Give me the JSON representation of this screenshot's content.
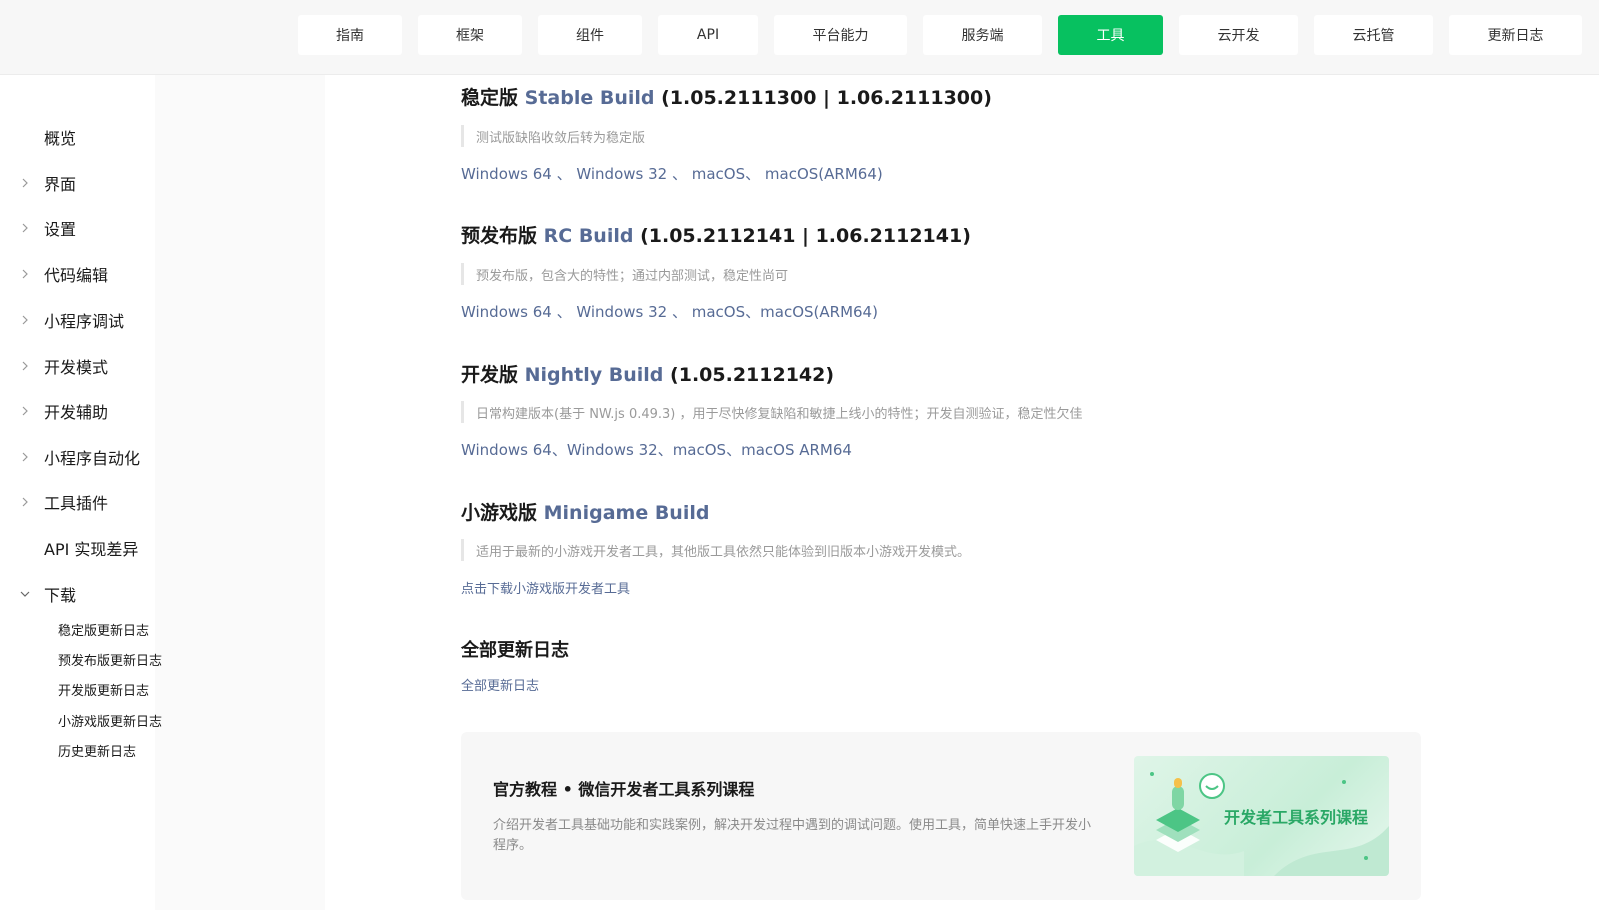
{
  "topnav": {
    "tabs": [
      {
        "label": "指南"
      },
      {
        "label": "框架"
      },
      {
        "label": "组件"
      },
      {
        "label": "API"
      },
      {
        "label": "平台能力"
      },
      {
        "label": "服务端"
      },
      {
        "label": "工具",
        "active": true
      },
      {
        "label": "云开发"
      },
      {
        "label": "云托管"
      },
      {
        "label": "更新日志"
      }
    ]
  },
  "sidebar": {
    "items": [
      {
        "label": "概览",
        "chevron": "none"
      },
      {
        "label": "界面",
        "chevron": "right"
      },
      {
        "label": "设置",
        "chevron": "right"
      },
      {
        "label": "代码编辑",
        "chevron": "right"
      },
      {
        "label": "小程序调试",
        "chevron": "right"
      },
      {
        "label": "开发模式",
        "chevron": "right"
      },
      {
        "label": "开发辅助",
        "chevron": "right"
      },
      {
        "label": "小程序自动化",
        "chevron": "right"
      },
      {
        "label": "工具插件",
        "chevron": "right"
      },
      {
        "label": "API 实现差异",
        "chevron": "none"
      },
      {
        "label": "下载",
        "chevron": "down"
      }
    ],
    "subitems": [
      {
        "label": "稳定版更新日志"
      },
      {
        "label": "预发布版更新日志"
      },
      {
        "label": "开发版更新日志"
      },
      {
        "label": "小游戏版更新日志"
      },
      {
        "label": "历史更新日志"
      }
    ]
  },
  "sections": {
    "stable": {
      "title_cn": "稳定版",
      "title_en": "Stable Build",
      "version": "(1.05.2111300 | 1.06.2111300)",
      "note": "测试版缺陷收敛后转为稳定版",
      "links": [
        "Windows 64",
        "Windows 32",
        "macOS",
        "macOS(ARM64)"
      ],
      "seps": [
        " 、 ",
        " 、 ",
        "、 "
      ]
    },
    "rc": {
      "title_cn": "预发布版",
      "title_en": "RC Build",
      "version": "(1.05.2112141 | 1.06.2112141)",
      "note": "预发布版，包含大的特性；通过内部测试，稳定性尚可",
      "links": [
        "Windows 64",
        "Windows 32",
        "macOS",
        "macOS(ARM64)"
      ],
      "seps": [
        " 、 ",
        " 、 ",
        "、"
      ]
    },
    "nightly": {
      "title_cn": "开发版",
      "title_en": "Nightly Build",
      "version": "(1.05.2112142)",
      "note": "日常构建版本(基于 NW.js 0.49.3) ，用于尽快修复缺陷和敏捷上线小的特性；开发自测验证，稳定性欠佳",
      "links": [
        "Windows 64",
        "Windows 32",
        "macOS",
        "macOS ARM64"
      ],
      "seps": [
        "、",
        "、",
        "、"
      ]
    },
    "minigame": {
      "title_cn": "小游戏版",
      "title_en": "Minigame Build",
      "note": "适用于最新的小游戏开发者工具，其他版工具依然只能体验到旧版本小游戏开发模式。",
      "link": "点击下载小游戏版开发者工具"
    },
    "changelog": {
      "title": "全部更新日志",
      "link": "全部更新日志"
    }
  },
  "course_card": {
    "title": "官方教程 • 微信开发者工具系列课程",
    "description": "介绍开发者工具基础功能和实践案例，解决开发过程中遇到的调试问题。使用工具，简单快速上手开发小程序。",
    "banner_text": "开发者工具系列课程"
  },
  "colors": {
    "accent": "#07c160",
    "link": "#576b95"
  }
}
